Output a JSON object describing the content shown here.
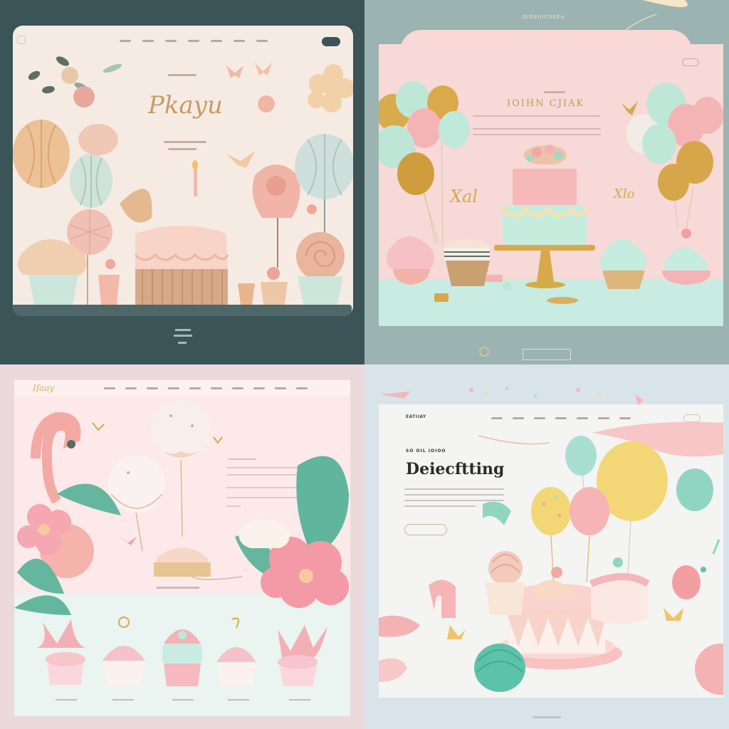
{
  "q1": {
    "script_title": "Pkayu",
    "colors": {
      "bg": "#3b5457",
      "card": "#f6ebe3",
      "shelf": "#4e6769"
    }
  },
  "q2": {
    "hero_title": "IOIHN CJIAK",
    "top_label": "OIOEIIICIIEEA",
    "colors": {
      "bg": "#9bb3b1",
      "card": "#f7d9d7"
    }
  },
  "q3": {
    "logo": "Ifaay",
    "colors": {
      "bg": "#ebd9db",
      "card": "#fde9ea"
    }
  },
  "q4": {
    "logo": "EATIIAY",
    "hero_title": "Deiecftting",
    "kicker": "SO OIL IOIOO",
    "colors": {
      "bg": "#d8e4ea",
      "card": "#f4f4f2"
    }
  }
}
